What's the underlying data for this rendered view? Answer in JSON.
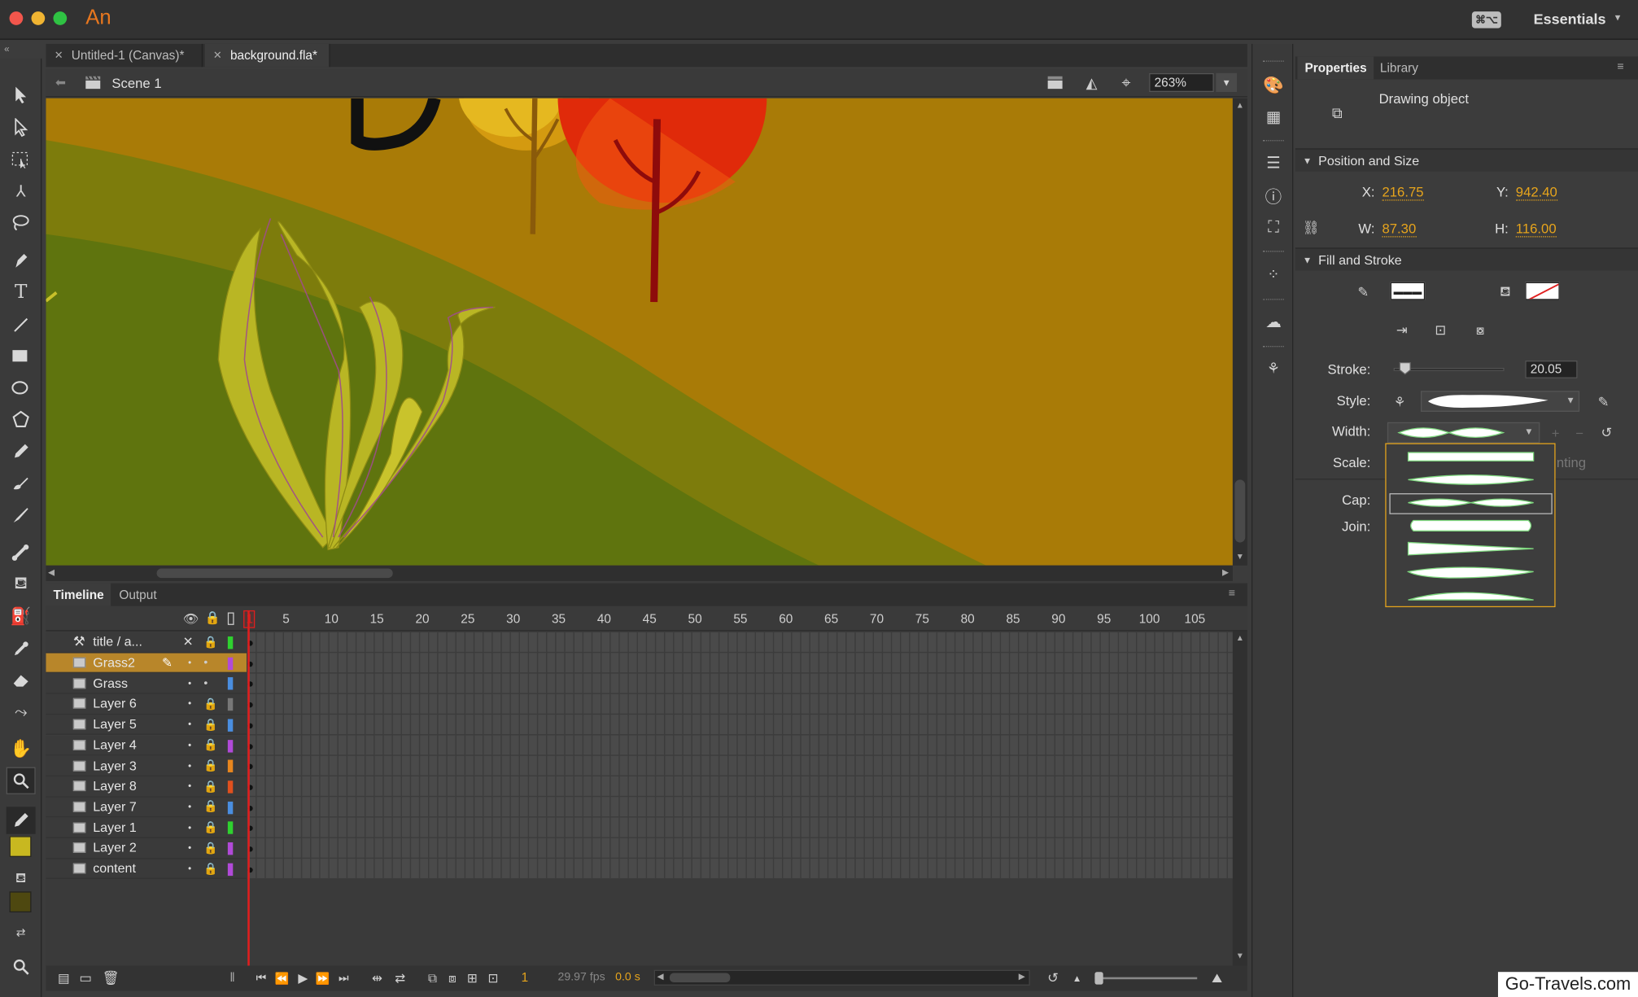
{
  "app": {
    "logo": "An",
    "workspace_label": "Essentials",
    "workspace_switch_icon": "keyboard-icon"
  },
  "tabs": [
    {
      "label": "Untitled-1 (Canvas)*",
      "active": false
    },
    {
      "label": "background.fla*",
      "active": true
    }
  ],
  "scene": {
    "label": "Scene 1",
    "zoom": "263%"
  },
  "timeline": {
    "tabs": [
      "Timeline",
      "Output"
    ],
    "frame_numbers": [
      "1",
      "5",
      "10",
      "15",
      "20",
      "25",
      "30",
      "35",
      "40",
      "45",
      "50",
      "55",
      "60",
      "65",
      "70",
      "75",
      "80",
      "85",
      "90",
      "95",
      "100",
      "105"
    ],
    "current_frame": "1",
    "fps": "29.97 fps",
    "time": "0.0 s",
    "layers": [
      {
        "name": "title / a...",
        "color": "#2fd12f",
        "locked": true,
        "selected": false,
        "type": "guide"
      },
      {
        "name": "Grass2",
        "color": "#b14ad8",
        "locked": false,
        "selected": true,
        "type": "normal"
      },
      {
        "name": "Grass",
        "color": "#4a8ee0",
        "locked": false,
        "selected": false,
        "type": "normal"
      },
      {
        "name": "Layer 6",
        "color": "#777777",
        "locked": true,
        "selected": false,
        "type": "normal"
      },
      {
        "name": "Layer 5",
        "color": "#4a8ee0",
        "locked": true,
        "selected": false,
        "type": "normal"
      },
      {
        "name": "Layer 4",
        "color": "#b14ad8",
        "locked": true,
        "selected": false,
        "type": "normal"
      },
      {
        "name": "Layer 3",
        "color": "#e8861e",
        "locked": true,
        "selected": false,
        "type": "normal"
      },
      {
        "name": "Layer 8",
        "color": "#e0501e",
        "locked": true,
        "selected": false,
        "type": "normal"
      },
      {
        "name": "Layer 7",
        "color": "#4a8ee0",
        "locked": true,
        "selected": false,
        "type": "normal"
      },
      {
        "name": "Layer 1",
        "color": "#2fd12f",
        "locked": true,
        "selected": false,
        "type": "normal"
      },
      {
        "name": "Layer 2",
        "color": "#b14ad8",
        "locked": true,
        "selected": false,
        "type": "normal"
      },
      {
        "name": "content",
        "color": "#b14ad8",
        "locked": true,
        "selected": false,
        "type": "normal"
      }
    ]
  },
  "properties": {
    "tabs": [
      "Properties",
      "Library"
    ],
    "object_type": "Drawing object",
    "position_size": {
      "title": "Position and Size",
      "x_label": "X:",
      "x": "216.75",
      "y_label": "Y:",
      "y": "942.40",
      "w_label": "W:",
      "w": "87.30",
      "h_label": "H:",
      "h": "116.00"
    },
    "fill_stroke": {
      "title": "Fill and Stroke",
      "stroke_label": "Stroke:",
      "stroke_value": "20.05",
      "stroke_slider_fraction": 0.05,
      "style_label": "Style:",
      "width_label": "Width:",
      "scale_label": "Scale:",
      "scale_value_faded": "nting",
      "cap_label": "Cap:",
      "join_label": "Join:",
      "width_profiles_count_selected_index": 2
    }
  },
  "colors": {
    "accent": "#e6a41c",
    "selected_layer": "#b8862a",
    "stroke_swatch": "#ffffff",
    "fill_color_tool": "#c8b820",
    "fill_color_dark": "#4e4810"
  },
  "watermark": "Go-Travels.com"
}
